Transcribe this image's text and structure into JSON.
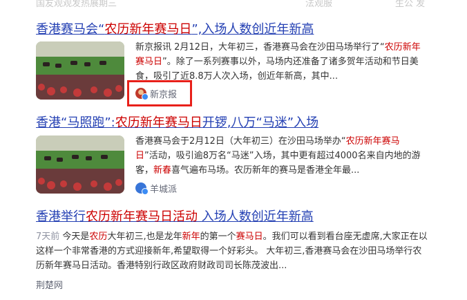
{
  "top_partial": {
    "left": "国友观观发热展期三",
    "mid": "法观服",
    "right": "生公 发"
  },
  "results": [
    {
      "title_parts": [
        {
          "text": "香港赛马会“",
          "hl": false
        },
        {
          "text": "农历新年赛马日",
          "hl": true
        },
        {
          "text": "”,入场人数创近年新高",
          "hl": false
        }
      ],
      "snippet_parts": [
        {
          "text": "新京报讯 2月12日，大年初三，香港赛马会在沙田马场举行了“",
          "hl": false
        },
        {
          "text": "农历新年赛马日",
          "hl": true
        },
        {
          "text": "”。除了一系列赛事以外，马场内还准备了诸多贺年活动和节日美食，吸引了近8.8万人次入场，创近年新高，其中...",
          "hl": false
        }
      ],
      "source": "新京报",
      "source_icon": "xinjingbao-logo-icon"
    },
    {
      "title_parts": [
        {
          "text": "香港“马照跑”:",
          "hl": false
        },
        {
          "text": "农历新年赛马日",
          "hl": true
        },
        {
          "text": "开锣,八万“马迷”入场",
          "hl": false
        }
      ],
      "snippet_parts": [
        {
          "text": "香港赛马会于2月12日（大年初三）在沙田马场举办“",
          "hl": false
        },
        {
          "text": "农历新年赛马日",
          "hl": true
        },
        {
          "text": "”活动，吸引逾8万名“马迷”入场，其中更有超过4000名来自内地的游客，",
          "hl": false
        },
        {
          "text": "新春",
          "hl": true
        },
        {
          "text": "喜气遍布马场。农历新年的赛马是香港全年最...",
          "hl": false
        }
      ],
      "source": "羊城派",
      "source_icon": "yangchengpai-logo-icon"
    },
    {
      "title_parts": [
        {
          "text": "香港举行",
          "hl": false
        },
        {
          "text": "农历新年赛马日活动",
          "hl": true
        },
        {
          "text": " 入场人数创近年新高",
          "hl": false
        }
      ],
      "time": "7天前",
      "snippet_parts": [
        {
          "text": " 今天是",
          "hl": false
        },
        {
          "text": "农历",
          "hl": true
        },
        {
          "text": "大年初三,也是龙年",
          "hl": false
        },
        {
          "text": "新年",
          "hl": true
        },
        {
          "text": "的第一个",
          "hl": false
        },
        {
          "text": "赛马日",
          "hl": true
        },
        {
          "text": "。我们可以看到看台座无虚席,大家正在以这样一个非常香港的方式迎接新年,希望取得一个好彩头。 大年初三,香港赛马会在沙田马场举行农历新年赛马日活动。香港特别行政区政府财政司司长陈茂波出...",
          "hl": false
        }
      ],
      "source": "荆楚网"
    }
  ],
  "colors": {
    "link": "#2440b3",
    "highlight": "#cc0000",
    "annotation_box": "#e8201a"
  }
}
